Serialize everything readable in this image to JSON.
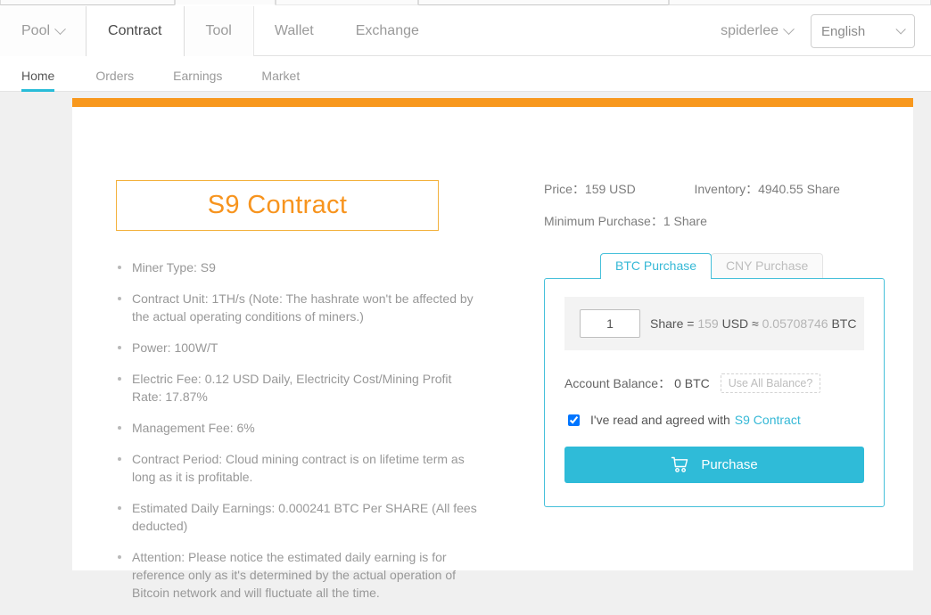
{
  "topnav": {
    "items": [
      {
        "label": "Pool",
        "has_caret": true,
        "active": false,
        "boxed": true
      },
      {
        "label": "Contract",
        "has_caret": false,
        "active": true,
        "boxed": true
      },
      {
        "label": "Tool",
        "has_caret": false,
        "active": false,
        "boxed": true
      },
      {
        "label": "Wallet",
        "has_caret": false,
        "active": false,
        "boxed": false
      },
      {
        "label": "Exchange",
        "has_caret": false,
        "active": false,
        "boxed": false
      }
    ],
    "user": "spiderlee",
    "language": "English"
  },
  "subnav": {
    "items": [
      {
        "label": "Home",
        "active": true
      },
      {
        "label": "Orders",
        "active": false
      },
      {
        "label": "Earnings",
        "active": false
      },
      {
        "label": "Market",
        "active": false
      }
    ]
  },
  "contract": {
    "title": "S9 Contract",
    "features": [
      "Miner Type: S9",
      "Contract Unit: 1TH/s (Note: The hashrate won't be affected by the actual operating conditions of miners.)",
      "Power: 100W/T",
      "Electric Fee: 0.12 USD Daily, Electricity Cost/Mining Profit Rate: 17.87%",
      "Management Fee: 6%",
      "Contract Period: Cloud mining contract is on lifetime term as long as it is profitable.",
      "Estimated Daily Earnings: 0.000241 BTC Per SHARE (All fees deducted)",
      "Attention: Please notice the estimated daily earning is for reference only as it's determined by the actual operation of Bitcoin network and will fluctuate all the time."
    ]
  },
  "summary": {
    "price_label": "Price：",
    "price_value": "159 USD",
    "inventory_label": "Inventory：",
    "inventory_value": "4940.55 Share",
    "minimum_label": "Minimum Purchase：",
    "minimum_value": "1 Share"
  },
  "purchase": {
    "tabs": [
      {
        "label": "BTC Purchase",
        "active": true
      },
      {
        "label": "CNY Purchase",
        "active": false
      }
    ],
    "quantity": "1",
    "quantity_placeholder": "1",
    "calc_share_label": "Share =",
    "calc_usd_amount": "159",
    "calc_usd_unit": "USD",
    "calc_approx": "≈",
    "calc_btc_amount": "0.05708746",
    "calc_btc_unit": "BTC",
    "balance_label": "Account Balance：",
    "balance_value": "0 BTC",
    "use_all_balance": "Use All Balance?",
    "agree_checked": true,
    "agree_text": "I've read and agreed with",
    "agree_link": "S9 Contract",
    "purchase_button": "Purchase",
    "cart_icon": "shopping-cart-icon"
  },
  "colors": {
    "orange_banner": "#f8981d",
    "title_orange": "#f7941e",
    "accent_teal": "#2fbbd8",
    "tab_teal": "#35b8d6"
  }
}
